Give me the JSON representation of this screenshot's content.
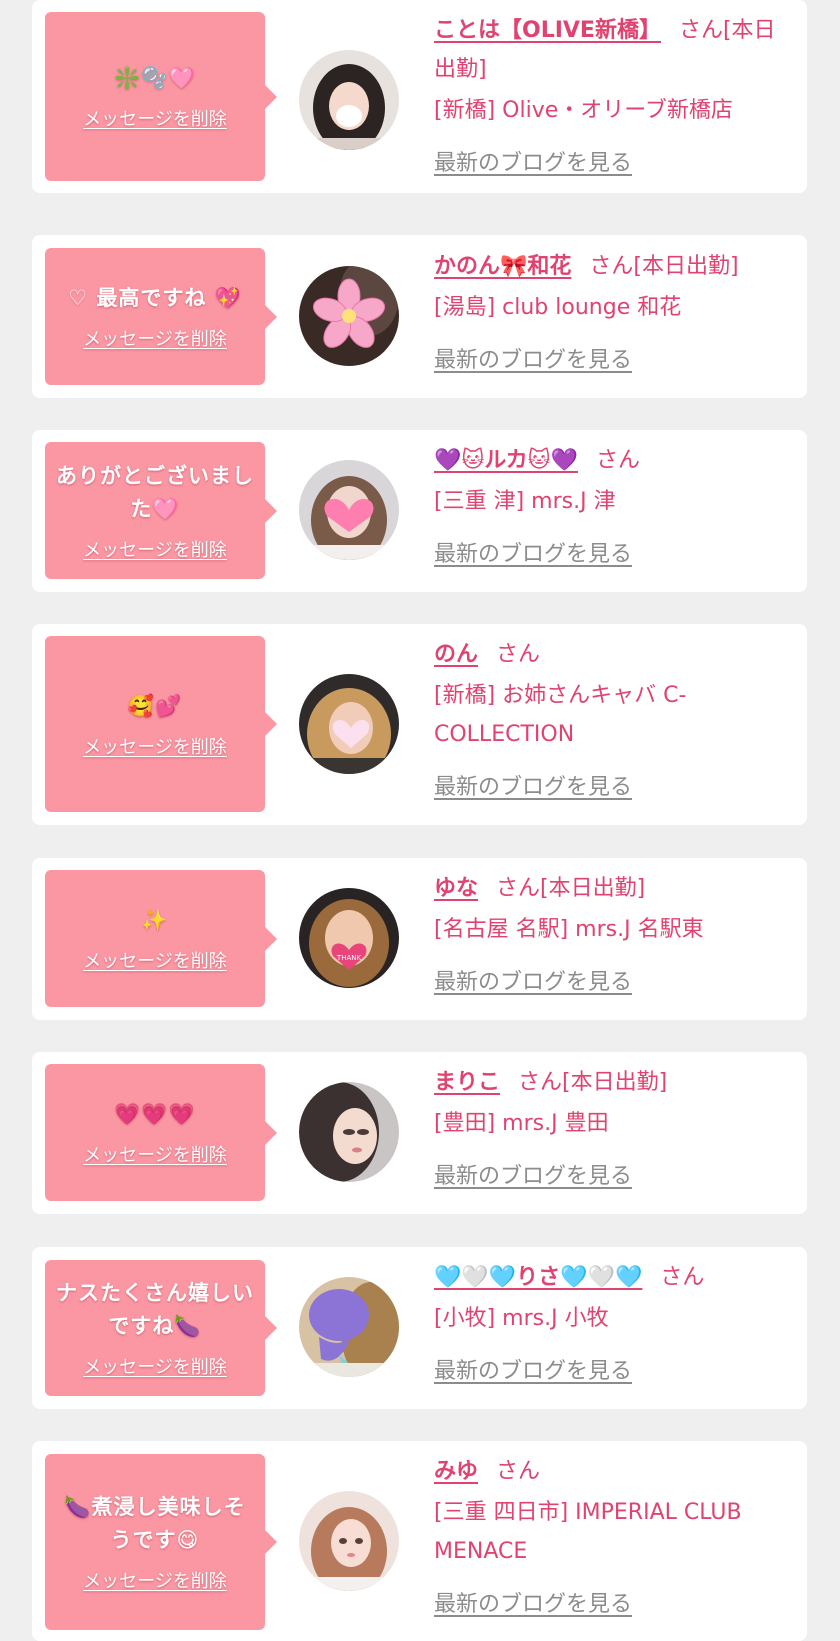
{
  "delete_label": "メッセージを削除",
  "blog_label": "最新のブログを見る",
  "colors": {
    "background": "#efefef",
    "card": "#ffffff",
    "bubble": "#fb97a3",
    "name": "#e0436f",
    "blog_link": "#8c8c8c"
  },
  "cards": [
    {
      "message": "❇️🫧🩷",
      "name": "ことは【OLIVE新橋】",
      "suffix": "さん[本日出勤]",
      "shop": "[新橋] Olive・オリーブ新橋店",
      "avatar_icon": "avatar-dark-hair-icon"
    },
    {
      "message": "♡ 最高ですね 💖",
      "name": "かのん🎀和花",
      "suffix": "さん[本日出勤]",
      "shop": "[湯島] club lounge 和花",
      "avatar_icon": "avatar-sakura-icon"
    },
    {
      "message": "ありがとございました🩷",
      "name": "💜🐱ルカ🐱💜",
      "suffix": "さん",
      "shop": "[三重 津] mrs.J 津",
      "avatar_icon": "avatar-heart-face-icon"
    },
    {
      "message": "🥰💕",
      "name": "のん",
      "suffix": "さん",
      "shop": "[新橋] お姉さんキャバ C-COLLECTION",
      "avatar_icon": "avatar-blonde-icon"
    },
    {
      "message": "✨",
      "name": "ゆな",
      "suffix": "さん[本日出勤]",
      "shop": "[名古屋 名駅] mrs.J 名駅東",
      "avatar_icon": "avatar-thank-you-mask-icon"
    },
    {
      "message": "💗💗💗",
      "name": "まりこ",
      "suffix": "さん[本日出勤]",
      "shop": "[豊田] mrs.J 豊田",
      "avatar_icon": "avatar-portrait-icon"
    },
    {
      "message": "ナスたくさん嬉しいですね🍆",
      "name": "🩵🤍🩵りさ🩵🤍🩵",
      "suffix": "さん",
      "shop": "[小牧] mrs.J 小牧",
      "avatar_icon": "avatar-purple-sticker-icon"
    },
    {
      "message": "🍆煮浸し美味しそうです😋",
      "name": "みゆ",
      "suffix": "さん",
      "shop": "[三重 四日市] IMPERIAL CLUB MENACE",
      "avatar_icon": "avatar-selfie-icon"
    }
  ]
}
